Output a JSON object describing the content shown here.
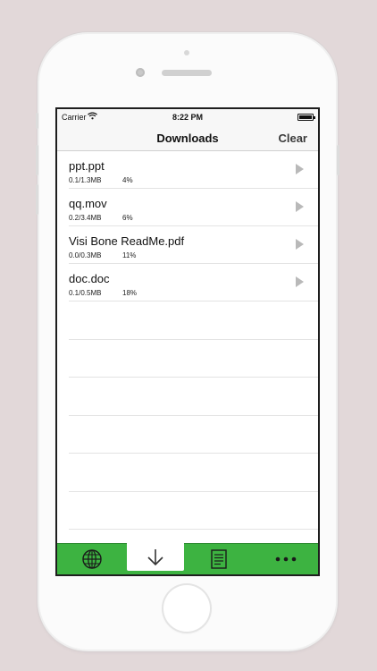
{
  "status_bar": {
    "carrier": "Carrier",
    "time": "8:22 PM"
  },
  "nav": {
    "title": "Downloads",
    "clear_label": "Clear"
  },
  "downloads": [
    {
      "name": "ppt.ppt",
      "size": "0.1/1.3MB",
      "percent": "4%"
    },
    {
      "name": "qq.mov",
      "size": "0.2/3.4MB",
      "percent": "6%"
    },
    {
      "name": "Visi Bone ReadMe.pdf",
      "size": "0.0/0.3MB",
      "percent": "11%"
    },
    {
      "name": "doc.doc",
      "size": "0.1/0.5MB",
      "percent": "18%"
    }
  ],
  "tabs": [
    {
      "icon": "globe-icon",
      "active": false
    },
    {
      "icon": "download-arrow-icon",
      "active": true
    },
    {
      "icon": "document-icon",
      "active": false
    },
    {
      "icon": "more-dots-icon",
      "active": false
    }
  ],
  "colors": {
    "tab_bar": "#3db341",
    "active_tab": "#ffffff",
    "play_icon": "#b9b9b9",
    "background": "#e2d8d9"
  }
}
